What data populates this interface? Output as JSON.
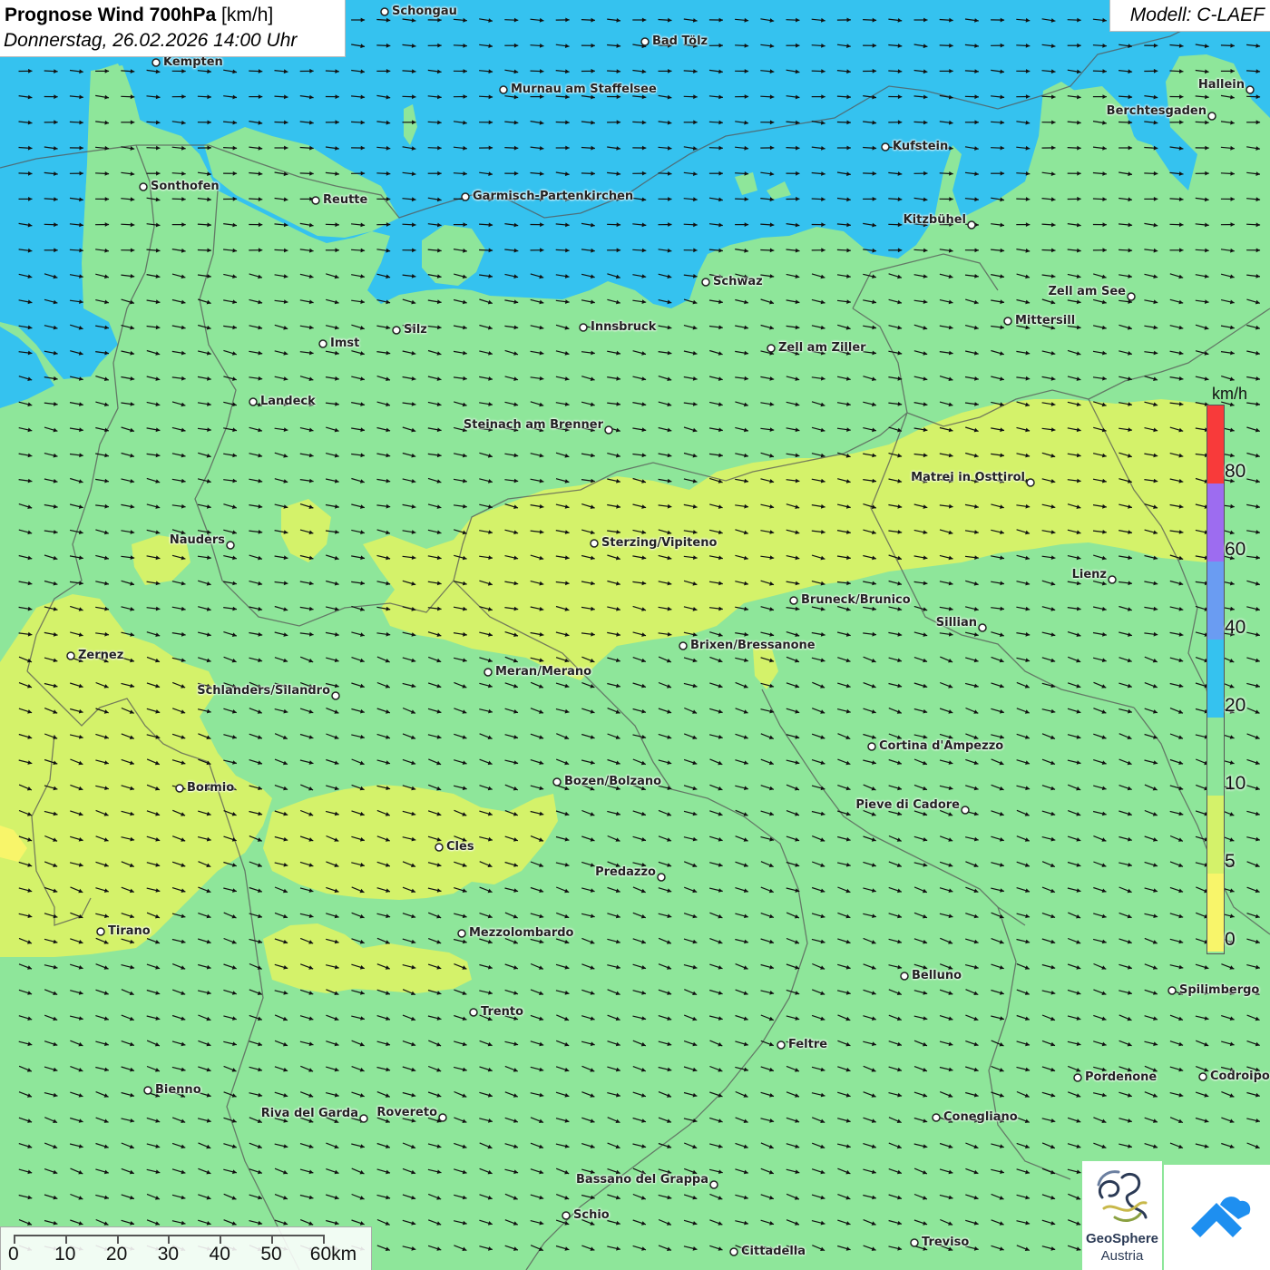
{
  "header": {
    "title_bold": "Prognose Wind 700hPa",
    "title_unit": "[km/h]",
    "datetime": "Donnerstag, 26.02.2026 14:00 Uhr"
  },
  "model": {
    "label": "Modell: C-LAEF"
  },
  "legend": {
    "unit": "km/h",
    "labels": [
      "80",
      "60",
      "40",
      "20",
      "10",
      "5",
      "0"
    ],
    "colors": [
      "#f83a3a",
      "#9d6cf0",
      "#6a9cf2",
      "#35c2ef",
      "#8ee69a",
      "#d4f26a",
      "#f8f56a"
    ]
  },
  "colors": {
    "blue_zone": "#35c2ef",
    "green_zone": "#8ee69a",
    "yellow_green_zone": "#d4f26a",
    "yellow_zone": "#f8f56a",
    "arrow": "#111111",
    "border": "#555555"
  },
  "scale": {
    "labels": [
      "0",
      "10",
      "20",
      "30",
      "40",
      "50",
      "60km"
    ]
  },
  "logos": {
    "geosphere_line1": "GeoSphere",
    "geosphere_line2": "Austria",
    "geosphere_icon": "geosphere-swirl-icon",
    "cloud_icon": "cloud-chevron-icon"
  },
  "cities": [
    {
      "name": "Schongau"
    },
    {
      "name": "Bad Tölz"
    },
    {
      "name": "Kempten"
    },
    {
      "name": "Murnau am Staffelsee"
    },
    {
      "name": "Hallein"
    },
    {
      "name": "Berchtesgaden"
    },
    {
      "name": "Kufstein"
    },
    {
      "name": "Sonthofen"
    },
    {
      "name": "Reutte"
    },
    {
      "name": "Garmisch-Partenkirchen"
    },
    {
      "name": "Kitzbühel"
    },
    {
      "name": "Schwaz"
    },
    {
      "name": "Zell am See"
    },
    {
      "name": "Mittersill"
    },
    {
      "name": "Innsbruck"
    },
    {
      "name": "Silz"
    },
    {
      "name": "Imst"
    },
    {
      "name": "Zell am Ziller"
    },
    {
      "name": "Landeck"
    },
    {
      "name": "Steinach am Brenner"
    },
    {
      "name": "Matrei in Osttirol"
    },
    {
      "name": "Nauders"
    },
    {
      "name": "Sterzing/Vipiteno"
    },
    {
      "name": "Lienz"
    },
    {
      "name": "Bruneck/Brunico"
    },
    {
      "name": "Sillian"
    },
    {
      "name": "Zernez"
    },
    {
      "name": "Brixen/Bressanone"
    },
    {
      "name": "Meran/Merano"
    },
    {
      "name": "Schlanders/Silandro"
    },
    {
      "name": "Cortina d'Ampezzo"
    },
    {
      "name": "Bormio"
    },
    {
      "name": "Bozen/Bolzano"
    },
    {
      "name": "Pieve di Cadore"
    },
    {
      "name": "Cles"
    },
    {
      "name": "Predazzo"
    },
    {
      "name": "Tirano"
    },
    {
      "name": "Mezzolombardo"
    },
    {
      "name": "Belluno"
    },
    {
      "name": "Spilimbergo"
    },
    {
      "name": "Trento"
    },
    {
      "name": "Feltre"
    },
    {
      "name": "Pordenone"
    },
    {
      "name": "Codroipo"
    },
    {
      "name": "Bienno"
    },
    {
      "name": "Riva del Garda"
    },
    {
      "name": "Rovereto"
    },
    {
      "name": "Conegliano"
    },
    {
      "name": "Bassano del Grappa"
    },
    {
      "name": "Schio"
    },
    {
      "name": "Treviso"
    },
    {
      "name": "Cittadella"
    }
  ]
}
